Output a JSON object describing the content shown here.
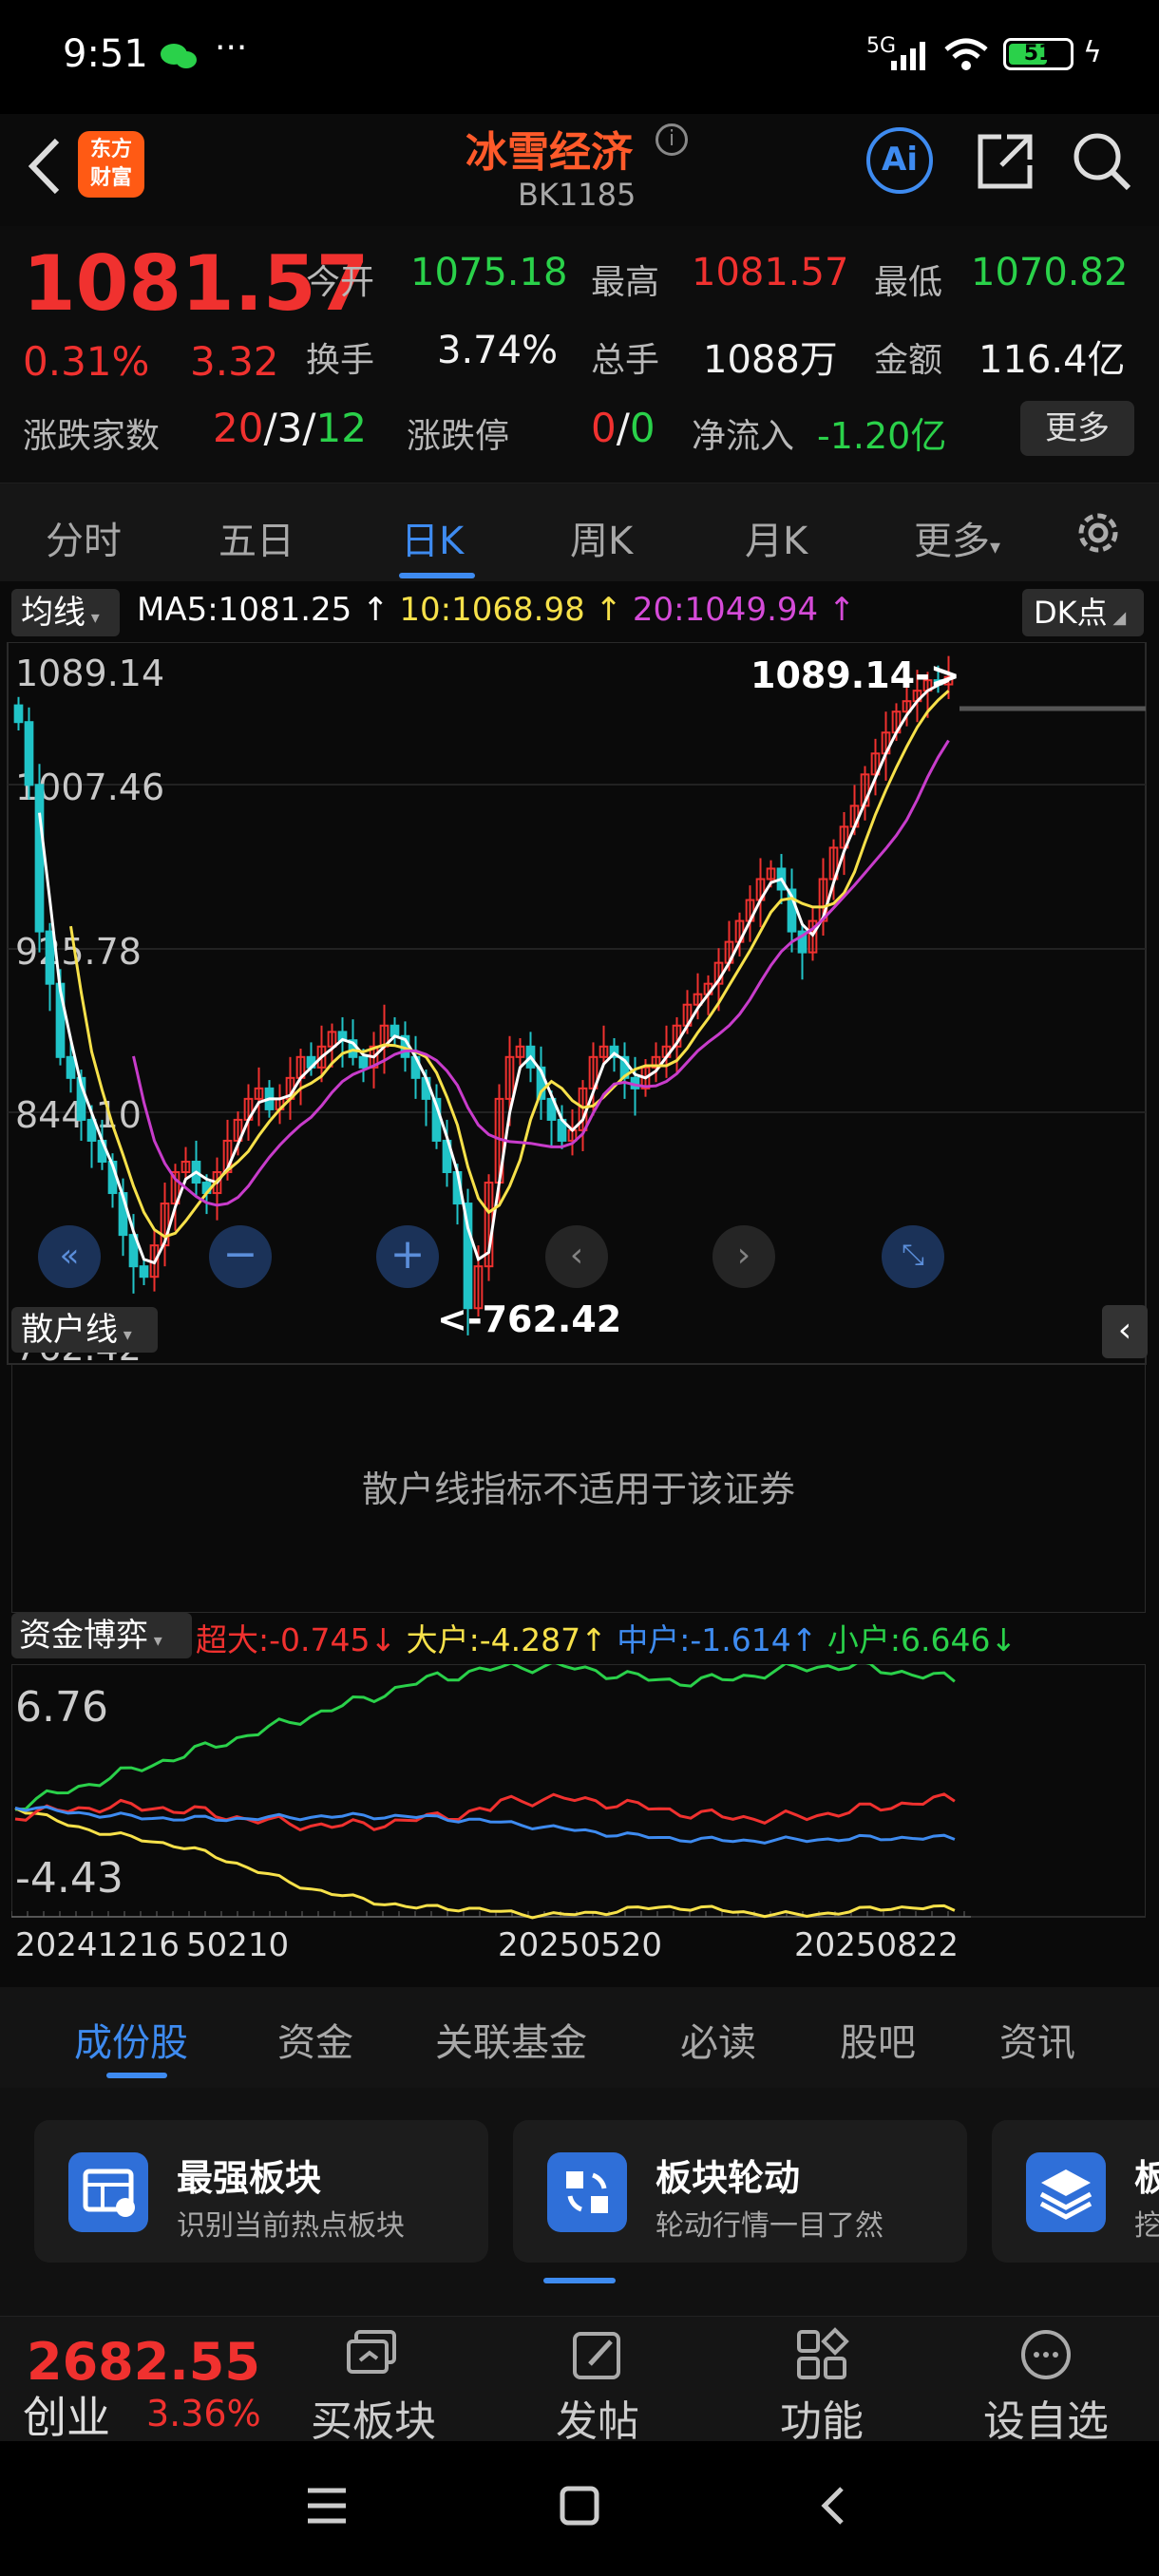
{
  "status": {
    "time": "9:51",
    "network": "5G",
    "battery": "51"
  },
  "header": {
    "logo_line1": "东方",
    "logo_line2": "财富",
    "title": "冰雪经济",
    "code": "BK1185",
    "ai_label": "Ai"
  },
  "quote": {
    "price": "1081.57",
    "pct": "0.31%",
    "chg": "3.32",
    "open_label": "今开",
    "open": "1075.18",
    "high_label": "最高",
    "high": "1081.57",
    "low_label": "最低",
    "low": "1070.82",
    "turnover_label": "换手",
    "turnover": "3.74%",
    "volume_label": "总手",
    "volume": "1088万",
    "amount_label": "金额",
    "amount": "116.4亿",
    "updown_label": "涨跌家数",
    "up": "20",
    "flat": "3",
    "down": "12",
    "sep": "/",
    "limit_label": "涨跌停",
    "limit_up": "0",
    "limit_down": "0",
    "netflow_label": "净流入",
    "netflow": "-1.20亿",
    "more_button": "更多"
  },
  "period_tabs": [
    "分时",
    "五日",
    "日K",
    "周K",
    "月K",
    "更多"
  ],
  "active_period": "日K",
  "ma_bar": {
    "selector": "均线",
    "ma5": "MA5:1081.25",
    "ma10": "10:1068.98",
    "ma20": "20:1049.94",
    "dk": "DK点"
  },
  "chart_data": {
    "type": "candlestick",
    "y_ticks": [
      "1089.14",
      "1007.46",
      "925.78",
      "844.10",
      "762.42"
    ],
    "ylim": [
      762.42,
      1089.14
    ],
    "max_label": "1089.14->",
    "min_label": "<-762.42",
    "series": [
      {
        "name": "MA5",
        "color": "#ffffff"
      },
      {
        "name": "10",
        "color": "#f7e14a"
      },
      {
        "name": "20",
        "color": "#c83ccb"
      }
    ],
    "closes": [
      1060,
      1030,
      960,
      935,
      900,
      890,
      870,
      860,
      850,
      835,
      815,
      800,
      795,
      810,
      830,
      845,
      850,
      840,
      835,
      845,
      860,
      870,
      880,
      885,
      875,
      880,
      890,
      900,
      895,
      905,
      912,
      908,
      900,
      895,
      905,
      915,
      910,
      900,
      890,
      880,
      860,
      845,
      830,
      780,
      800,
      840,
      880,
      900,
      905,
      895,
      880,
      870,
      860,
      865,
      885,
      900,
      905,
      900,
      890,
      885,
      895,
      900,
      905,
      915,
      925,
      930,
      935,
      945,
      955,
      965,
      975,
      985,
      990,
      980,
      960,
      950,
      965,
      985,
      1000,
      1010,
      1020,
      1035,
      1045,
      1055,
      1065,
      1070,
      1075,
      1080,
      1078,
      1081.57
    ]
  },
  "retail_panel": {
    "selector": "散户线",
    "message": "散户线指标不适用于该证券"
  },
  "fund_panel": {
    "selector": "资金博弈",
    "super": "超大:-0.745",
    "big": "大户:-4.287",
    "mid": "中户:-1.614",
    "small": "小户:6.646",
    "y_top": "6.76",
    "y_bottom": "-4.43",
    "dates": [
      "20241216",
      "50210",
      "20250520",
      "20250822"
    ]
  },
  "info_tabs": [
    "成份股",
    "资金",
    "关联基金",
    "必读",
    "股吧",
    "资讯"
  ],
  "active_info_tab": "成份股",
  "cards": [
    {
      "title": "最强板块",
      "sub": "识别当前热点板块"
    },
    {
      "title": "板块轮动",
      "sub": "轮动行情一目了然"
    },
    {
      "title": "板",
      "sub": "挖"
    }
  ],
  "bottom_nav": {
    "index_value": "2682.55",
    "index_name": "创业",
    "index_pct": "3.36%",
    "items": [
      "买板块",
      "发帖",
      "功能",
      "设自选"
    ]
  }
}
